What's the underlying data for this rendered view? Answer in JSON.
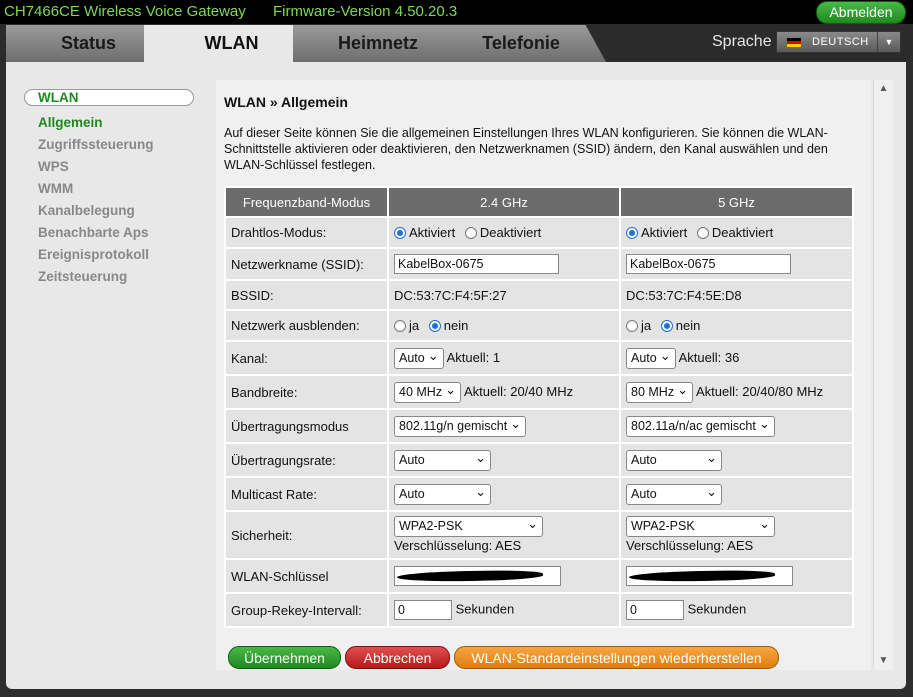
{
  "header": {
    "model": "CH7466CE  Wireless Voice Gateway",
    "firmware": "Firmware-Version  4.50.20.3",
    "logout_label": "Abmelden"
  },
  "nav": {
    "tabs": [
      {
        "label": "Status",
        "active": false
      },
      {
        "label": "WLAN",
        "active": true
      },
      {
        "label": "Heimnetz",
        "active": false
      },
      {
        "label": "Telefonie",
        "active": false
      }
    ],
    "language_label": "Sprache",
    "language_value": "DEUTSCH"
  },
  "sidebar": {
    "items": [
      {
        "label": "WLAN"
      },
      {
        "label": "Allgemein"
      },
      {
        "label": "Zugriffssteuerung"
      },
      {
        "label": "WPS"
      },
      {
        "label": "WMM"
      },
      {
        "label": "Kanalbelegung"
      },
      {
        "label": "Benachbarte Aps"
      },
      {
        "label": "Ereignisprotokoll"
      },
      {
        "label": "Zeitsteuerung"
      }
    ]
  },
  "main": {
    "title": "WLAN » Allgemein",
    "description": "Auf dieser Seite können Sie die allgemeinen Einstellungen Ihres WLAN konfigurieren. Sie können die WLAN-Schnittstelle aktivieren oder deaktivieren, den Netzwerknamen (SSID) ändern, den Kanal auswählen und den WLAN-Schlüssel festlegen.",
    "table": {
      "headers": [
        "Frequenzband-Modus",
        "2.4 GHz",
        "5 GHz"
      ],
      "labels": {
        "mode": "Drahtlos-Modus:",
        "ssid": "Netzwerkname (SSID):",
        "bssid": "BSSID:",
        "hide": "Netzwerk ausblenden:",
        "channel": "Kanal:",
        "bandwidth": "Bandbreite:",
        "tmode": "Übertragungsmodus",
        "rate": "Übertragungsrate:",
        "mcast": "Multicast Rate:",
        "security": "Sicherheit:",
        "key": "WLAN-Schlüssel",
        "rekey": "Group-Rekey-Intervall:"
      },
      "radio": {
        "activated": "Aktiviert",
        "deactivated": "Deaktiviert",
        "yes": "ja",
        "no": "nein"
      },
      "seconds": "Sekunden",
      "band24": {
        "ssid": "KabelBox-0675",
        "bssid": "DC:53:7C:F4:5F:27",
        "channel": "Auto",
        "channel_current": "Aktuell: 1",
        "bandwidth": "40 MHz",
        "bandwidth_current": "Aktuell: 20/40 MHz",
        "tmode": "802.11g/n gemischt",
        "rate": "Auto",
        "mcast": "Auto",
        "security": "WPA2-PSK",
        "encryption": "Verschlüsselung: AES",
        "rekey": "0"
      },
      "band5": {
        "ssid": "KabelBox-0675",
        "bssid": "DC:53:7C:F4:5E:D8",
        "channel": "Auto",
        "channel_current": "Aktuell: 36",
        "bandwidth": "80 MHz",
        "bandwidth_current": "Aktuell: 20/40/80 MHz",
        "tmode": "802.11a/n/ac gemischt",
        "rate": "Auto",
        "mcast": "Auto",
        "security": "WPA2-PSK",
        "encryption": "Verschlüsselung: AES",
        "rekey": "0"
      }
    },
    "buttons": {
      "apply": "Übernehmen",
      "cancel": "Abbrechen",
      "defaults": "WLAN-Standardeinstellungen wiederherstellen"
    }
  },
  "colors": {
    "accent_green": "#1e8a1e",
    "header_text_green": "#7ed957",
    "cancel_red": "#c82020",
    "defaults_orange": "#ee9020"
  }
}
